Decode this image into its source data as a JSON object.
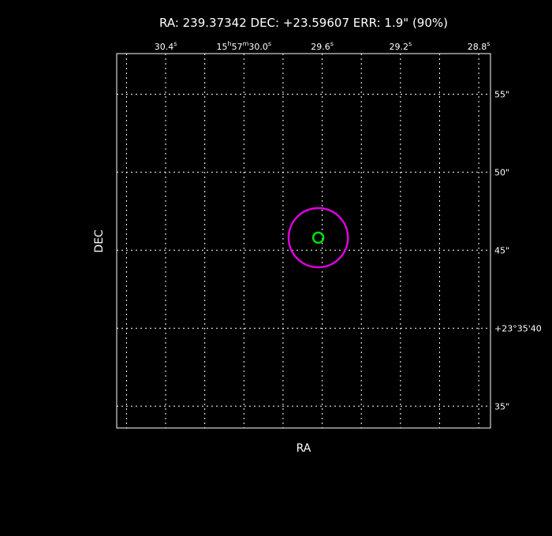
{
  "chart_data": {
    "type": "scatter",
    "title": "RA: 239.37342   DEC: +23.59607   ERR: 1.9\" (90%)",
    "xlabel": "RA",
    "ylabel": "DEC",
    "grid": true,
    "x_ticks": [
      {
        "h": "",
        "m": "",
        "s": "30.4",
        "value_sec": 30.4
      },
      {
        "h": "15",
        "m": "57",
        "s": "30.0",
        "value_sec": 30.0
      },
      {
        "h": "",
        "m": "",
        "s": "29.6",
        "value_sec": 29.6
      },
      {
        "h": "",
        "m": "",
        "s": "29.2",
        "value_sec": 29.2
      },
      {
        "h": "",
        "m": "",
        "s": "28.8",
        "value_sec": 28.8
      }
    ],
    "y_ticks": [
      {
        "label": "55\"",
        "value_arcsec": 55
      },
      {
        "label": "50\"",
        "value_arcsec": 50
      },
      {
        "label": "45\"",
        "value_arcsec": 45
      },
      {
        "label": "+23°35'40",
        "value_arcsec": 40
      },
      {
        "label": "35\"",
        "value_arcsec": 35
      }
    ],
    "xlim_sec": [
      30.65,
      28.74
    ],
    "ylim_arcsec": [
      33.6,
      57.6
    ],
    "source": {
      "ra_sec": 29.62,
      "dec_arcsec": 45.8
    },
    "error_circle": {
      "radius_arcsec": 1.9,
      "color": "#e000e0"
    },
    "marker": {
      "color": "#00e000"
    }
  }
}
